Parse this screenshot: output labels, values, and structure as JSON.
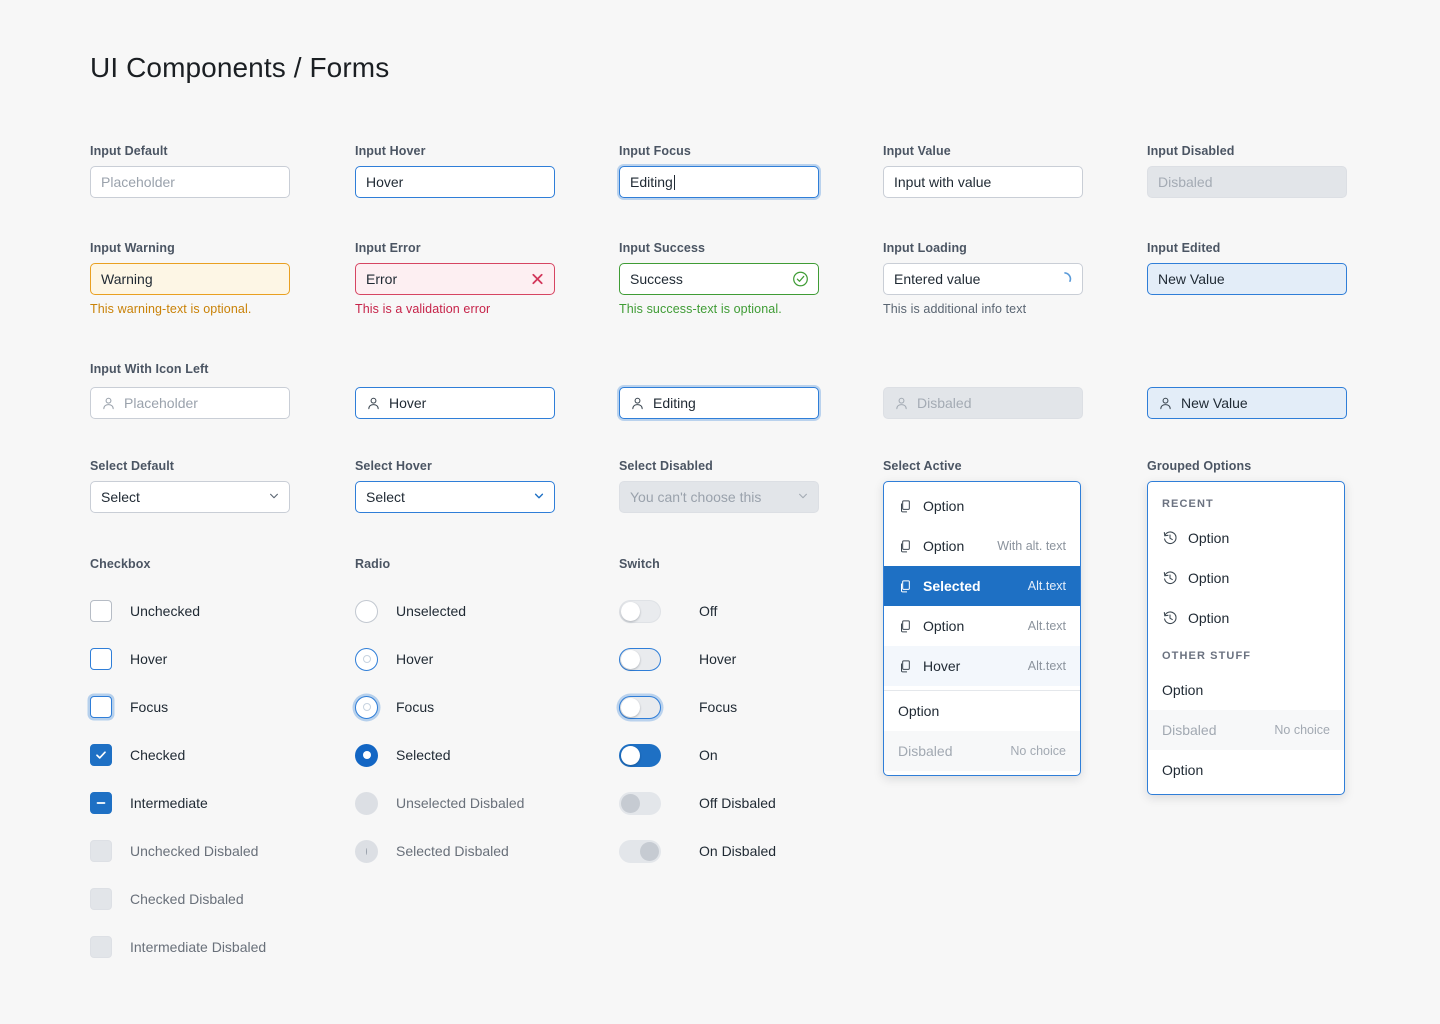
{
  "page": {
    "title": "UI Components / Forms"
  },
  "inputs": {
    "default": {
      "label": "Input Default",
      "placeholder": "Placeholder"
    },
    "hover": {
      "label": "Input Hover",
      "value": "Hover"
    },
    "focus": {
      "label": "Input Focus",
      "value": "Editing"
    },
    "value": {
      "label": "Input Value",
      "value": "Input with value"
    },
    "disabled": {
      "label": "Input Disabled",
      "value": "Disbaled"
    },
    "warning": {
      "label": "Input Warning",
      "value": "Warning",
      "helper": "This warning-text is optional."
    },
    "error": {
      "label": "Input Error",
      "value": "Error",
      "helper": "This is a validation error",
      "icon": "close-icon"
    },
    "success": {
      "label": "Input Success",
      "value": "Success",
      "helper": "This success-text is optional.",
      "icon": "check-circle-icon"
    },
    "loading": {
      "label": "Input Loading",
      "value": "Entered value",
      "helper": "This is additional info text",
      "icon": "spinner-icon"
    },
    "edited": {
      "label": "Input Edited",
      "value": "New Value"
    }
  },
  "icon_inputs": {
    "label": "Input With Icon Left",
    "items": [
      {
        "state": "default",
        "placeholder": "Placeholder"
      },
      {
        "state": "hover",
        "value": "Hover"
      },
      {
        "state": "focus",
        "value": "Editing"
      },
      {
        "state": "disabled",
        "value": "Disbaled"
      },
      {
        "state": "edited",
        "value": "New Value"
      }
    ]
  },
  "selects": {
    "default": {
      "label": "Select Default",
      "value": "Select"
    },
    "hover": {
      "label": "Select Hover",
      "value": "Select"
    },
    "disabled": {
      "label": "Select Disabled",
      "value": "You can't choose this"
    },
    "active": {
      "label": "Select Active"
    },
    "grouped": {
      "label": "Grouped Options"
    }
  },
  "select_active_items": [
    {
      "label": "Option",
      "alt": "",
      "state": "normal",
      "icon": "copy-icon"
    },
    {
      "label": "Option",
      "alt": "With alt. text",
      "state": "normal",
      "icon": "copy-icon"
    },
    {
      "label": "Selected",
      "alt": "Alt.text",
      "state": "selected",
      "icon": "copy-icon"
    },
    {
      "label": "Option",
      "alt": "Alt.text",
      "state": "normal",
      "icon": "copy-icon"
    },
    {
      "label": "Hover",
      "alt": "Alt.text",
      "state": "hovered",
      "icon": "copy-icon"
    },
    {
      "label": "Option",
      "alt": "",
      "state": "normal",
      "icon": ""
    },
    {
      "label": "Disbaled",
      "alt": "No choice",
      "state": "disabled",
      "icon": ""
    }
  ],
  "grouped_options": [
    {
      "type": "group",
      "label": "RECENT"
    },
    {
      "type": "item",
      "label": "Option",
      "alt": "",
      "state": "normal",
      "icon": "history-icon"
    },
    {
      "type": "item",
      "label": "Option",
      "alt": "",
      "state": "normal",
      "icon": "history-icon"
    },
    {
      "type": "item",
      "label": "Option",
      "alt": "",
      "state": "normal",
      "icon": "history-icon"
    },
    {
      "type": "group",
      "label": "OTHER STUFF"
    },
    {
      "type": "item",
      "label": "Option",
      "alt": "",
      "state": "normal",
      "icon": ""
    },
    {
      "type": "item",
      "label": "Disbaled",
      "alt": "No choice",
      "state": "disabled",
      "icon": ""
    },
    {
      "type": "item",
      "label": "Option",
      "alt": "",
      "state": "normal",
      "icon": ""
    }
  ],
  "checkbox": {
    "title": "Checkbox",
    "items": [
      {
        "label": "Unchecked",
        "state": "unchecked"
      },
      {
        "label": "Hover",
        "state": "hover"
      },
      {
        "label": "Focus",
        "state": "focus"
      },
      {
        "label": "Checked",
        "state": "checked"
      },
      {
        "label": "Intermediate",
        "state": "intermediate"
      },
      {
        "label": "Unchecked Disbaled",
        "state": "unchecked-disabled"
      },
      {
        "label": "Checked Disbaled",
        "state": "checked-disabled"
      },
      {
        "label": "Intermediate Disbaled",
        "state": "intermediate-disabled"
      }
    ]
  },
  "radio": {
    "title": "Radio",
    "items": [
      {
        "label": "Unselected",
        "state": "unselected"
      },
      {
        "label": "Hover",
        "state": "hover"
      },
      {
        "label": "Focus",
        "state": "focus"
      },
      {
        "label": "Selected",
        "state": "selected"
      },
      {
        "label": "Unselected Disbaled",
        "state": "unselected-disabled"
      },
      {
        "label": "Selected Disbaled",
        "state": "selected-disabled"
      }
    ]
  },
  "switch": {
    "title": "Switch",
    "items": [
      {
        "label": "Off",
        "state": "off"
      },
      {
        "label": "Hover",
        "state": "hover"
      },
      {
        "label": "Focus",
        "state": "focus"
      },
      {
        "label": "On",
        "state": "on"
      },
      {
        "label": "Off Disbaled",
        "state": "off-disabled"
      },
      {
        "label": "On Disbaled",
        "state": "on-disabled"
      }
    ]
  },
  "colors": {
    "background": "#f7f7f7",
    "accent": "#1e70c4",
    "border": "#c9ced6",
    "warning": "#e9a021",
    "error": "#d64562",
    "success": "#3f9c35",
    "disabled_bg": "#e2e5e9",
    "text": "#1f2933",
    "muted": "#9aa2ac"
  }
}
